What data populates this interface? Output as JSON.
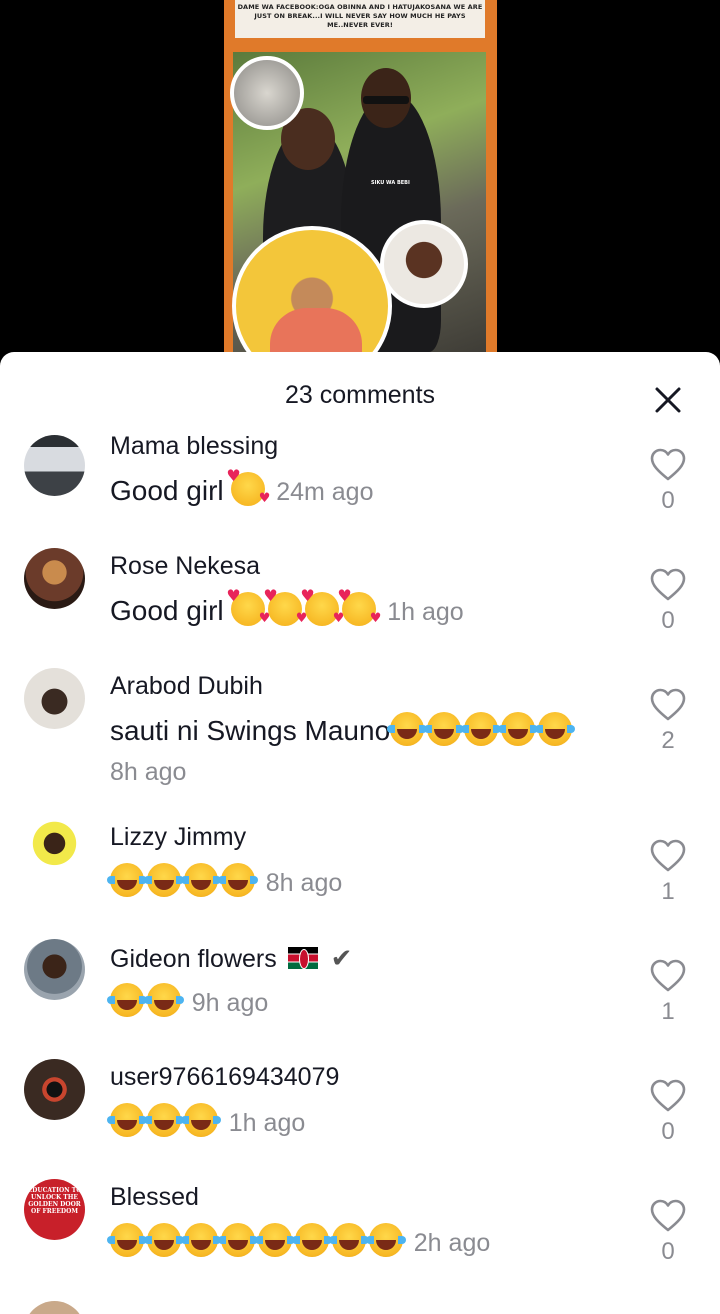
{
  "poster": {
    "banner_text": "DAME WA FACEBOOK:OGA OBINNA AND I HATUJAKOSANA WE ARE JUST ON BREAK...I WILL NEVER SAY HOW MUCH HE PAYS ME..NEVER EVER!",
    "shirt_text": "SIKU WA BEBI"
  },
  "sheet": {
    "title": "23 comments",
    "close_icon": "close-icon"
  },
  "comments": [
    {
      "username": "Mama blessing",
      "text": "Good girl",
      "emoji": "smiling-face-with-hearts",
      "time": "24m ago",
      "likes": "0",
      "avatar_color": "#b9bcc2"
    },
    {
      "username": "Rose Nekesa",
      "text": "Good girl",
      "emoji": "smiling-face-with-hearts x4",
      "time": "1h ago",
      "likes": "0",
      "avatar_color": "#6b3b2a"
    },
    {
      "username": "Arabod Dubih",
      "text": "sauti ni Swings Mauno",
      "emoji": "tears-of-joy x5",
      "time": "8h ago",
      "likes": "2",
      "avatar_color": "#c9c4bd"
    },
    {
      "username": "Lizzy Jimmy",
      "text": "",
      "emoji": "tears-of-joy x4",
      "time": "8h ago",
      "likes": "1",
      "avatar_color": "#f2e94a"
    },
    {
      "username": "Gideon flowers",
      "text": "",
      "emoji": "tears-of-joy x2",
      "time": "9h ago",
      "likes": "1",
      "avatar_color": "#6d7a86"
    },
    {
      "username": "user9766169434079",
      "text": "",
      "emoji": "tears-of-joy x3",
      "time": "1h ago",
      "likes": "0",
      "avatar_color": "#3a2a22"
    },
    {
      "username": "Blessed",
      "text": "",
      "emoji": "tears-of-joy x8",
      "time": "2h ago",
      "likes": "0",
      "avatar_color": "#c8202a",
      "avatar_text": "EDUCATION TO UNLOCK THE GOLDEN DOOR OF FREEDOM"
    }
  ],
  "icons": {
    "like": "heart-outline-icon",
    "close": "close-icon",
    "verified": "check-mark-icon",
    "flag": "kenya-flag-icon"
  }
}
